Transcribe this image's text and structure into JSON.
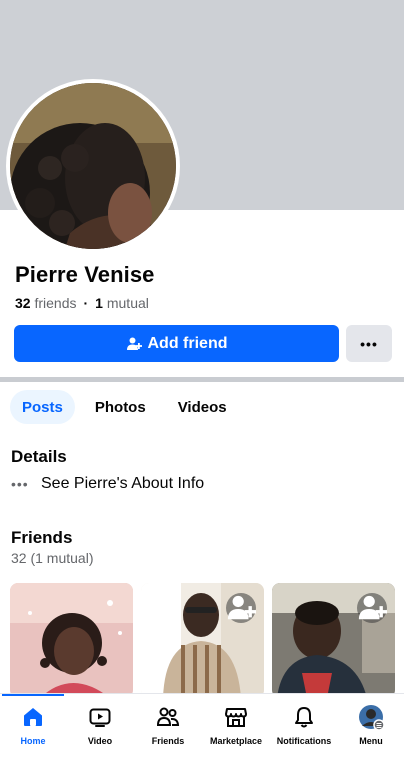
{
  "profile": {
    "name": "Pierre Venise",
    "friends_count": "32",
    "friends_label": "friends",
    "mutual_count": "1",
    "mutual_label": "mutual"
  },
  "actions": {
    "add_friend_label": "Add friend",
    "more_label": "•••"
  },
  "tabs": [
    {
      "label": "Posts",
      "active": true
    },
    {
      "label": "Photos",
      "active": false
    },
    {
      "label": "Videos",
      "active": false
    }
  ],
  "details": {
    "title": "Details",
    "about_label": "See Pierre's About Info"
  },
  "friends": {
    "title": "Friends",
    "count_label": "32 (1 mutual)"
  },
  "bottom_nav": [
    {
      "label": "Home",
      "icon": "home-icon",
      "active": true
    },
    {
      "label": "Video",
      "icon": "video-icon",
      "active": false
    },
    {
      "label": "Friends",
      "icon": "friends-icon",
      "active": false
    },
    {
      "label": "Marketplace",
      "icon": "marketplace-icon",
      "active": false
    },
    {
      "label": "Notifications",
      "icon": "bell-icon",
      "active": false
    },
    {
      "label": "Menu",
      "icon": "menu-avatar-icon",
      "active": false
    }
  ],
  "colors": {
    "accent": "#0866ff",
    "cover": "#cdd0d5",
    "secondary_button": "#e4e6eb",
    "active_tab_bg": "#ebf5ff"
  }
}
